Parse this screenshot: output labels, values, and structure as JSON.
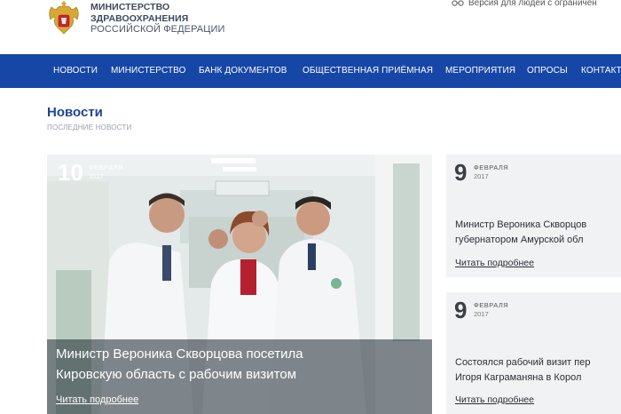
{
  "header": {
    "ministry_line1": "МИНИСТЕРСТВО",
    "ministry_line2": "ЗДРАВООХРАНЕНИЯ",
    "ministry_line3": "РОССИЙСКОЙ ФЕДЕРАЦИИ",
    "accessibility_label": "Версия для людей с ограничен"
  },
  "nav": {
    "items": [
      "НОВОСТИ",
      "МИНИСТЕРСТВО",
      "БАНК ДОКУМЕНТОВ",
      "ОБЩЕСТВЕННАЯ ПРИЁМНАЯ",
      "МЕРОПРИЯТИЯ",
      "ОПРОСЫ",
      "КОНТАКТ"
    ]
  },
  "section": {
    "title": "Новости",
    "subtitle": "ПОСЛЕДНИЕ НОВОСТИ"
  },
  "featured": {
    "day": "10",
    "month": "ФЕВРАЛЯ",
    "year": "2017",
    "title_line1": "Министр Вероника Скворцова посетила",
    "title_line2": "Кировскую область с рабочим визитом",
    "link": "Читать подробнее"
  },
  "cards": [
    {
      "day": "9",
      "month": "ФЕВРАЛЯ",
      "year": "2017",
      "title_line1": "Министр Вероника Скворцов",
      "title_line2": "губернатором Амурской обл",
      "link": "Читать подробнее"
    },
    {
      "day": "9",
      "month": "ФЕВРАЛЯ",
      "year": "2017",
      "title_line1": "Состоялся рабочий визит пер",
      "title_line2": "Игоря Каграманяна в Корол",
      "link": "Читать подробнее"
    }
  ],
  "colors": {
    "nav_bg": "#1747a6",
    "title_blue": "#1f4496",
    "card_bg": "#f1f2f4"
  }
}
